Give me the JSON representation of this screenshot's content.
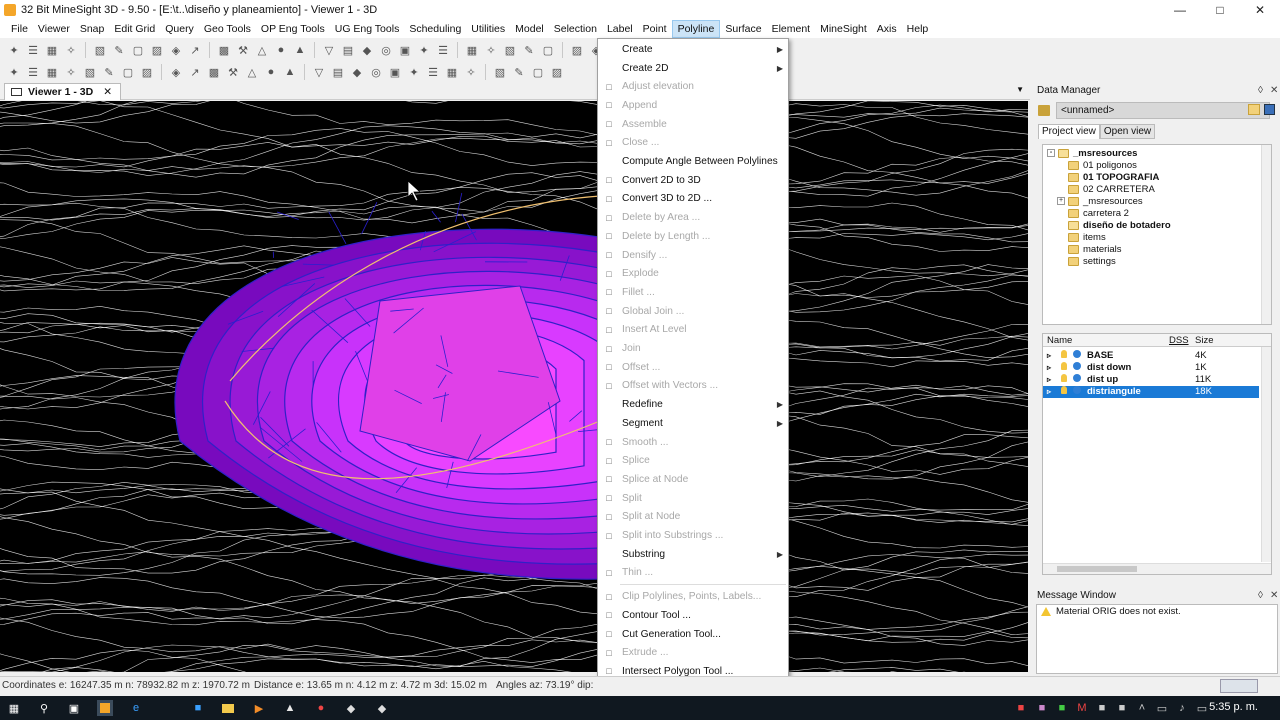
{
  "window": {
    "title": "32 Bit MineSight 3D  - 9.50 - [E:\\t..\\diseño y planeamiento] - Viewer 1 - 3D"
  },
  "menubar": [
    "File",
    "Viewer",
    "Snap",
    "Edit Grid",
    "Query",
    "Geo Tools",
    "OP Eng Tools",
    "UG Eng Tools",
    "Scheduling",
    "Utilities",
    "Model",
    "Selection",
    "Label",
    "Point",
    "Polyline",
    "Surface",
    "Element",
    "MineSight",
    "Axis",
    "Help"
  ],
  "active_menu": "Polyline",
  "viewer_tab": {
    "label": "Viewer 1 - 3D"
  },
  "polyline_menu": [
    {
      "label": "Create",
      "disabled": false,
      "submenu": true,
      "icon": ""
    },
    {
      "label": "Create 2D",
      "disabled": false,
      "submenu": true,
      "icon": ""
    },
    {
      "label": "Adjust elevation",
      "disabled": true,
      "submenu": false,
      "icon": "adjust-icon"
    },
    {
      "label": "Append",
      "disabled": true,
      "submenu": false,
      "icon": "append-icon"
    },
    {
      "label": "Assemble",
      "disabled": true,
      "submenu": false,
      "icon": "assemble-icon"
    },
    {
      "label": "Close ...",
      "disabled": true,
      "submenu": false,
      "icon": "close-polyline-icon"
    },
    {
      "label": "Compute Angle Between Polylines",
      "disabled": false,
      "submenu": false,
      "icon": ""
    },
    {
      "label": "Convert 2D to 3D",
      "disabled": false,
      "submenu": false,
      "icon": "convert-2d-3d-icon"
    },
    {
      "label": "Convert 3D to 2D ...",
      "disabled": false,
      "submenu": false,
      "icon": "convert-3d-2d-icon"
    },
    {
      "label": "Delete by Area ...",
      "disabled": true,
      "submenu": false,
      "icon": "delete-area-icon"
    },
    {
      "label": "Delete by Length ...",
      "disabled": true,
      "submenu": false,
      "icon": "delete-length-icon"
    },
    {
      "label": "Densify ...",
      "disabled": true,
      "submenu": false,
      "icon": "densify-icon"
    },
    {
      "label": "Explode",
      "disabled": true,
      "submenu": false,
      "icon": "explode-icon"
    },
    {
      "label": "Fillet ...",
      "disabled": true,
      "submenu": false,
      "icon": "fillet-icon"
    },
    {
      "label": "Global Join ...",
      "disabled": true,
      "submenu": false,
      "icon": "global-join-icon"
    },
    {
      "label": "Insert At Level",
      "disabled": true,
      "submenu": false,
      "icon": "insert-level-icon"
    },
    {
      "label": "Join",
      "disabled": true,
      "submenu": false,
      "icon": "join-icon"
    },
    {
      "label": "Offset ...",
      "disabled": true,
      "submenu": false,
      "icon": "offset-icon"
    },
    {
      "label": "Offset with Vectors ...",
      "disabled": true,
      "submenu": false,
      "icon": "offset-vectors-icon"
    },
    {
      "label": "Redefine",
      "disabled": false,
      "submenu": true,
      "icon": ""
    },
    {
      "label": "Segment",
      "disabled": false,
      "submenu": true,
      "icon": ""
    },
    {
      "label": "Smooth ...",
      "disabled": true,
      "submenu": false,
      "icon": "smooth-icon"
    },
    {
      "label": "Splice",
      "disabled": true,
      "submenu": false,
      "icon": "splice-icon"
    },
    {
      "label": "Splice at Node",
      "disabled": true,
      "submenu": false,
      "icon": "splice-node-icon"
    },
    {
      "label": "Split",
      "disabled": true,
      "submenu": false,
      "icon": "split-icon"
    },
    {
      "label": "Split at Node",
      "disabled": true,
      "submenu": false,
      "icon": "split-node-icon"
    },
    {
      "label": "Split into Substrings ...",
      "disabled": true,
      "submenu": false,
      "icon": "split-substrings-icon"
    },
    {
      "label": "Substring",
      "disabled": false,
      "submenu": true,
      "icon": ""
    },
    {
      "label": "Thin ...",
      "disabled": true,
      "submenu": false,
      "icon": "thin-icon"
    },
    {
      "label": "Clip Polylines, Points, Labels...",
      "disabled": true,
      "submenu": false,
      "icon": "clip-icon"
    },
    {
      "label": "Contour Tool ...",
      "disabled": false,
      "submenu": false,
      "icon": "contour-icon"
    },
    {
      "label": "Cut Generation Tool...",
      "disabled": false,
      "submenu": false,
      "icon": "cut-generation-icon"
    },
    {
      "label": "Extrude ...",
      "disabled": true,
      "submenu": false,
      "icon": "extrude-icon"
    },
    {
      "label": "Intersect Polygon Tool ...",
      "disabled": false,
      "submenu": false,
      "icon": "intersect-polygon-icon"
    }
  ],
  "data_manager": {
    "title": "Data Manager",
    "project": "<unnamed>",
    "tabs": [
      "Project view",
      "Open view"
    ],
    "tree": [
      {
        "label": "_msresources",
        "bold": true,
        "level": 0,
        "expander": "-",
        "folder": "open"
      },
      {
        "label": "01 poligonos",
        "bold": false,
        "level": 1,
        "expander": "",
        "folder": "closed"
      },
      {
        "label": "01 TOPOGRAFIA",
        "bold": true,
        "level": 1,
        "expander": "",
        "folder": "closed"
      },
      {
        "label": "02 CARRETERA",
        "bold": false,
        "level": 1,
        "expander": "",
        "folder": "closed"
      },
      {
        "label": "_msresources",
        "bold": false,
        "level": 1,
        "expander": "+",
        "folder": "closed"
      },
      {
        "label": "carretera 2",
        "bold": false,
        "level": 1,
        "expander": "",
        "folder": "closed"
      },
      {
        "label": "diseño de botadero",
        "bold": true,
        "level": 1,
        "expander": "",
        "folder": "open"
      },
      {
        "label": "items",
        "bold": false,
        "level": 1,
        "expander": "",
        "folder": "closed"
      },
      {
        "label": "materials",
        "bold": false,
        "level": 1,
        "expander": "",
        "folder": "closed"
      },
      {
        "label": "settings",
        "bold": false,
        "level": 1,
        "expander": "",
        "folder": "closed"
      }
    ],
    "files_header": {
      "name": "Name",
      "dss": "DSS",
      "size": "Size"
    },
    "files": [
      {
        "name": "BASE",
        "size": "4K",
        "selected": false
      },
      {
        "name": "dist down",
        "size": "1K",
        "selected": false
      },
      {
        "name": "dist up",
        "size": "11K",
        "selected": false
      },
      {
        "name": "distriangule",
        "size": "18K",
        "selected": true
      }
    ]
  },
  "message_window": {
    "title": "Message Window",
    "messages": [
      "Material ORIG does not exist."
    ]
  },
  "statusbar": {
    "coordinates": "Coordinates  e: 16247.35 m  n: 78932.82 m  z: 1970.72 m",
    "distance": "Distance  e: 13.65 m  n: 4.12 m  z: 4.72 m  3d: 15.02 m",
    "angles": "Angles  az: 73.19°  dip:"
  },
  "taskbar": {
    "clock": "5:35 p. m."
  },
  "colors": {
    "accent": "#1a7ad6",
    "viewport_bg": "#000000",
    "pit_magenta": "#e040e8",
    "contour": "#ffffff"
  }
}
